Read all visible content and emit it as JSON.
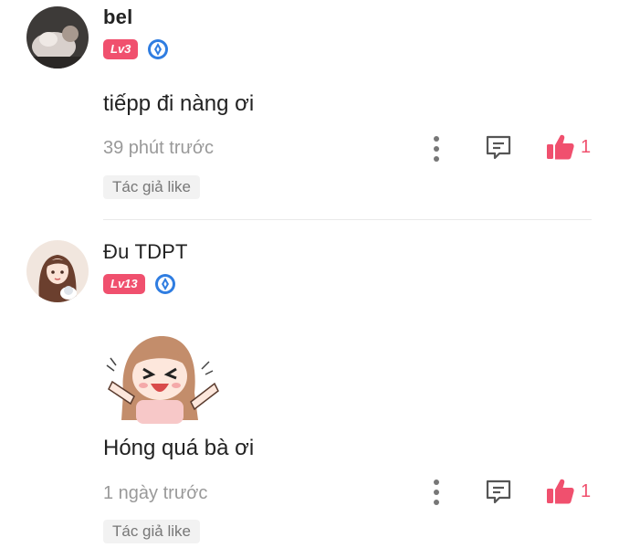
{
  "comments": [
    {
      "username": "bel",
      "level": "Lv3",
      "text": "tiếpp đi nàng ơi",
      "time": "39 phút trước",
      "author_liked": "Tác giả like",
      "like_count": "1"
    },
    {
      "username": "Đu TDPT",
      "level": "Lv13",
      "text": "Hóng quá bà ơi",
      "time": "1 ngày trước",
      "author_liked": "Tác giả like",
      "like_count": "1"
    }
  ],
  "colors": {
    "accent": "#f0506e",
    "muted": "#999999",
    "gem": "#2f7de1"
  },
  "icons": {
    "more": "more-vertical-icon",
    "reply": "comment-icon",
    "like": "thumbs-up-icon",
    "rank": "diamond-badge-icon"
  }
}
